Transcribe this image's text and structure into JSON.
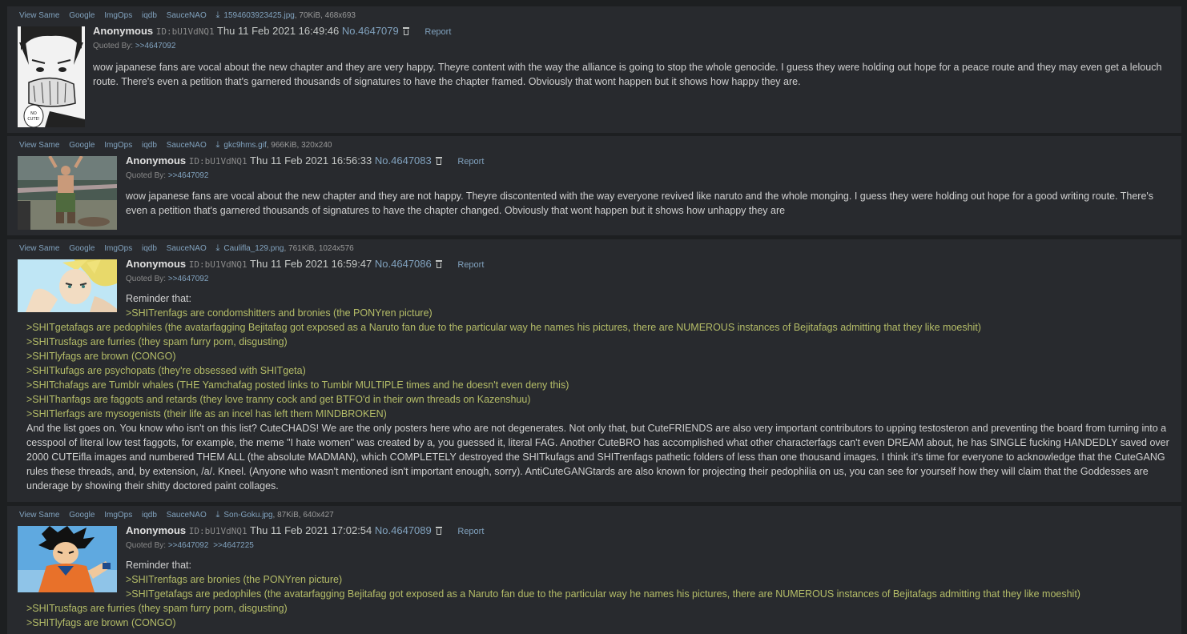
{
  "posts": [
    {
      "file_links": [
        "View Same",
        "Google",
        "ImgOps",
        "iqdb",
        "SauceNAO"
      ],
      "filename": "1594603923425.jpg",
      "filemeta": ", 70KiB, 468x693",
      "name": "Anonymous",
      "poster_id": "ID:bU1VdNQ1",
      "date": "Thu 11 Feb 2021 16:49:46",
      "number": "No.4647079",
      "report": "Report",
      "quoted_label": "Quoted By:",
      "quoted_by": [
        ">>4647092"
      ],
      "text": "wow japanese fans are vocal about the new chapter and they are very happy. Theyre content with the way the alliance is going to stop the whole genocide. I guess they were holding out hope for a peace route and they may even get a lelouch route. There's even a petition that's garnered thousands of signatures to have the chapter framed. Obviously that wont happen but it shows how happy they are.",
      "thumb_label": "NO\nCUTE!"
    },
    {
      "file_links": [
        "View Same",
        "Google",
        "ImgOps",
        "iqdb",
        "SauceNAO"
      ],
      "filename": "gkc9hms.gif",
      "filemeta": ", 966KiB, 320x240",
      "name": "Anonymous",
      "poster_id": "ID:bU1VdNQ1",
      "date": "Thu 11 Feb 2021 16:56:33",
      "number": "No.4647083",
      "report": "Report",
      "quoted_label": "Quoted By:",
      "quoted_by": [
        ">>4647092"
      ],
      "text": "wow japanese fans are vocal about the new chapter and they are not happy. Theyre discontented with the way everyone revived like naruto and the whole monging. I guess they were holding out hope for a good writing route. There's even a petition that's garnered thousands of signatures to have the chapter changed. Obviously that wont happen but it shows how unhappy they are"
    },
    {
      "file_links": [
        "View Same",
        "Google",
        "ImgOps",
        "iqdb",
        "SauceNAO"
      ],
      "filename": "Caulifla_129.png",
      "filemeta": ", 761KiB, 1024x576",
      "name": "Anonymous",
      "poster_id": "ID:bU1VdNQ1",
      "date": "Thu 11 Feb 2021 16:59:47",
      "number": "No.4647086",
      "report": "Report",
      "quoted_label": "Quoted By:",
      "quoted_by": [
        ">>4647092"
      ],
      "lines": [
        "Reminder that:",
        ">SHITrenfags are condomshitters and bronies (the PONYren picture)",
        ">SHITgetafags are pedophiles (the avatarfagging Bejitafag got exposed as a Naruto fan due to the particular way he names his pictures, there are NUMEROUS instances of Bejitafags admitting that they like moeshit)",
        ">SHITrusfags are furries (they spam furry porn, disgusting)",
        ">SHITlyfags are brown (CONGO)",
        ">SHITkufags are psychopats (they're obsessed with SHITgeta)",
        ">SHITchafags are Tumblr whales (THE Yamchafag posted links to Tumblr MULTIPLE times and he doesn't even deny this)",
        ">SHIThanfags are faggots and retards (they love tranny cock and get BTFO'd in their own threads on Kazenshuu)",
        ">SHITlerfags are mysogenists (their life as an incel has left them MINDBROKEN)"
      ],
      "paragraph": "And the list goes on. You know who isn't on this list? CuteCHADS! We are the only posters here who are not degenerates. Not only that, but CuteFRIENDS are also very important contributors to upping testosteron and preventing the board from turning into a cesspool of literal low test faggots, for example, the meme \"I hate women\" was created by a, you guessed it, literal FAG. Another CuteBRO has accomplished what other characterfags can't even DREAM about, he has SINGLE fucking HANDEDLY saved over 2000 CUTEifla images and numbered THEM ALL (the absolute MADMAN), which COMPLETELY destroyed the SHITkufags and SHITrenfags pathetic folders of less than one thousand images. I think it's time for everyone to acknowledge that the CuteGANG rules these threads, and, by extension, /a/. Kneel. (Anyone who wasn't mentioned isn't important enough, sorry). AntiCuteGANGtards are also known for projecting their pedophilia on us, you can see for yourself how they will claim that the Goddesses are underage by showing their shitty doctored paint collages."
    },
    {
      "file_links": [
        "View Same",
        "Google",
        "ImgOps",
        "iqdb",
        "SauceNAO"
      ],
      "filename": "Son-Goku.jpg",
      "filemeta": ", 87KiB, 640x427",
      "name": "Anonymous",
      "poster_id": "ID:bU1VdNQ1",
      "date": "Thu 11 Feb 2021 17:02:54",
      "number": "No.4647089",
      "report": "Report",
      "quoted_label": "Quoted By:",
      "quoted_by": [
        ">>4647092",
        ">>4647225"
      ],
      "lines": [
        "Reminder that:",
        ">SHITrenfags are bronies (the PONYren picture)",
        ">SHITgetafags are pedophiles (the avatarfagging Bejitafag got exposed as a Naruto fan due to the particular way he names his pictures, there are NUMEROUS instances of Bejitafags admitting that they like moeshit)",
        ">SHITrusfags are furries (they spam furry porn, disgusting)",
        ">SHITlyfags are brown (CONGO)"
      ]
    }
  ],
  "colors": {
    "background": "#1d1f21",
    "post": "#282a2e",
    "link": "#81a2be",
    "greentext": "#b5bd68"
  }
}
